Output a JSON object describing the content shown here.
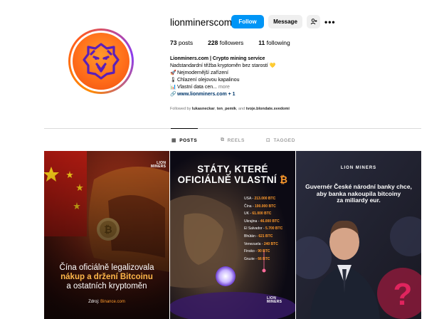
{
  "profile": {
    "username": "lionminerscom",
    "follow_label": "Follow",
    "message_label": "Message",
    "suggest_icon": "add-person-icon",
    "more_icon": "ellipsis-icon",
    "avatar_icon": "lion-logo-icon"
  },
  "stats": {
    "posts_count": "73",
    "posts_label": "posts",
    "followers_count": "228",
    "followers_label": "followers",
    "following_count": "11",
    "following_label": "following"
  },
  "bio": {
    "name": "Lionminers.com | Crypto mining service",
    "line1": "Nadstandardní těžba kryptoměn bez starostí",
    "line2": "Nejmodernější zařízení",
    "line3": "Chlazení olejovou kapalinou",
    "line4": "Vlastní data cen...",
    "more": "more",
    "link": "www.lionminers.com + 1",
    "followed_prefix": "Followed by",
    "followed_user1": "lukasneckar",
    "followed_user2": "ten_pemik",
    "followed_and": "and",
    "followed_user3": "tvoje.blondate.svedomi"
  },
  "tabs": [
    {
      "label": "POSTS",
      "icon": "grid-icon"
    },
    {
      "label": "REELS",
      "icon": "reels-icon"
    },
    {
      "label": "TAGGED",
      "icon": "tagged-icon"
    }
  ],
  "posts": {
    "p1": {
      "logo_line1": "LION",
      "logo_line2": "MINERS",
      "caption_line1": "Čína oficiálně legalizovala",
      "caption_line2a": "nákup a držení ",
      "caption_line2b": "Bitcoinu",
      "caption_line3": "a ostatních kryptoměn",
      "source_prefix": "Zdroj: ",
      "source": "Binance.com"
    },
    "p2": {
      "title_line1": "STÁTY, KTERÉ",
      "title_line2": "OFICIÁLNĚ VLASTNÍ",
      "logo_line1": "LION",
      "logo_line2": "MINERS",
      "holdings": [
        {
          "country": "USA",
          "value": "213.000 BTC"
        },
        {
          "country": "Čína",
          "value": "190.000 BTC"
        },
        {
          "country": "UK",
          "value": "61.000 BTC"
        },
        {
          "country": "Ukrajina",
          "value": "46.000 BTC"
        },
        {
          "country": "El Salvador",
          "value": "5.700 BTC"
        },
        {
          "country": "Bhútán",
          "value": "621 BTC"
        },
        {
          "country": "Venezuela",
          "value": "240 BTC"
        },
        {
          "country": "Finsko",
          "value": "90 BTC"
        },
        {
          "country": "Gruzie",
          "value": "66 BTC"
        }
      ]
    },
    "p3": {
      "logo": "LION MINERS",
      "caption_line1": "Guvernér České národní banky chce,",
      "caption_line2": "aby banka nakoupila bitcoiny",
      "caption_line3": "za miliardy eur."
    }
  },
  "colors": {
    "follow_blue": "#0095f6",
    "accent_orange": "#ff9a2c",
    "link_blue": "#00376b"
  }
}
